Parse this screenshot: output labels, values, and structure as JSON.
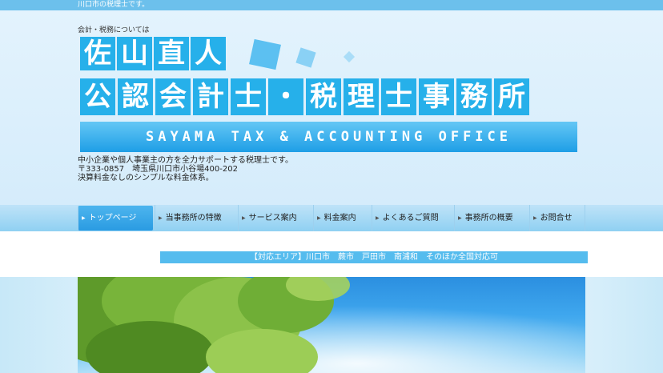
{
  "topbar": {
    "text": "川口市の税理士です。"
  },
  "header": {
    "tagline": "会計・税務については",
    "logo_row1": [
      "佐",
      "山",
      "直",
      "人"
    ],
    "logo_row2": [
      "公",
      "認",
      "会",
      "計",
      "士",
      "・",
      "税",
      "理",
      "士",
      "事",
      "務",
      "所"
    ],
    "banner": "SAYAMA TAX & ACCOUNTING OFFICE",
    "intro": [
      "中小企業や個人事業主の方を全力サポートする税理士です。",
      "〒333-0857　埼玉県川口市小谷場400-202",
      "決算料金なしのシンプルな料金体系。"
    ]
  },
  "nav": {
    "items": [
      {
        "label": "トップページ",
        "active": true
      },
      {
        "label": "当事務所の特徴"
      },
      {
        "label": "サービス案内"
      },
      {
        "label": "料金案内"
      },
      {
        "label": "よくあるご質問"
      },
      {
        "label": "事務所の概要"
      },
      {
        "label": "お問合せ"
      }
    ]
  },
  "area": {
    "text": "【対応エリア】川口市　蕨市　戸田市　南浦和　そのほか全国対応可"
  },
  "colors": {
    "accent": "#26b0ea",
    "topbar": "#6cc0ec",
    "nav_active": "#2a9be2"
  }
}
